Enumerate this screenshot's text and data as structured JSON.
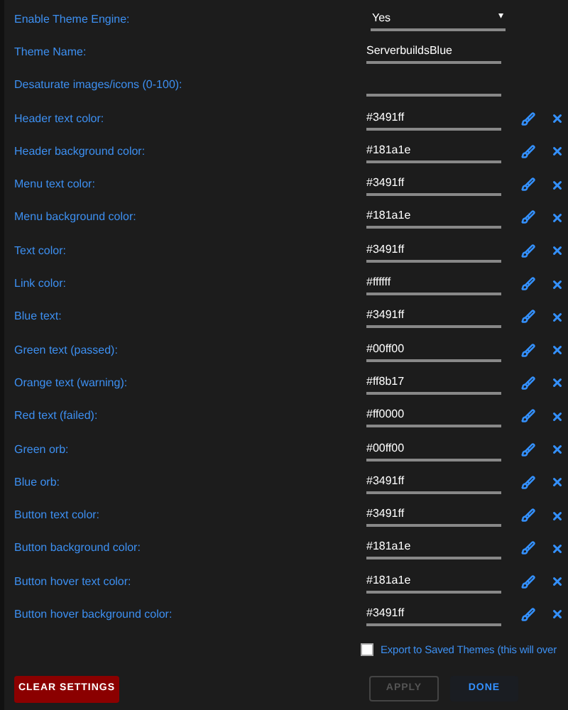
{
  "fields": [
    {
      "kind": "select",
      "label": "Enable Theme Engine:",
      "value": "Yes",
      "caret": "▾"
    },
    {
      "kind": "text",
      "label": "Theme Name:",
      "value": "ServerbuildsBlue"
    },
    {
      "kind": "text",
      "label": "Desaturate images/icons (0-100):"
    },
    {
      "kind": "color",
      "label": "Header text color:",
      "value": "#3491ff"
    },
    {
      "kind": "color",
      "label": "Header background color:",
      "value": "#181a1e"
    },
    {
      "kind": "color",
      "label": "Menu text color:",
      "value": "#3491ff"
    },
    {
      "kind": "color",
      "label": "Menu background color:",
      "value": "#181a1e"
    },
    {
      "kind": "color",
      "label": "Text color:",
      "value": "#3491ff"
    },
    {
      "kind": "color",
      "label": "Link color:",
      "value": "#ffffff"
    },
    {
      "kind": "color",
      "label": "Blue text:",
      "value": "#3491ff"
    },
    {
      "kind": "color",
      "label": "Green text (passed):",
      "value": "#00ff00"
    },
    {
      "kind": "color",
      "label": "Orange text (warning):",
      "value": "#ff8b17"
    },
    {
      "kind": "color",
      "label": "Red text (failed):",
      "value": "#ff0000"
    },
    {
      "kind": "color",
      "label": "Green orb:",
      "value": "#00ff00"
    },
    {
      "kind": "color",
      "label": "Blue orb:",
      "value": "#3491ff"
    },
    {
      "kind": "color",
      "label": "Button text color:",
      "value": "#3491ff"
    },
    {
      "kind": "color",
      "label": "Button background color:",
      "value": "#181a1e"
    },
    {
      "kind": "color",
      "label": "Button hover text color:",
      "value": "#181a1e"
    },
    {
      "kind": "color",
      "label": "Button hover background color:",
      "value": "#3491ff"
    }
  ],
  "export": {
    "label": "Export to Saved Themes (this will over",
    "checked": false
  },
  "buttons": {
    "clear": {
      "label": "CLEAR SETTINGS"
    },
    "apply": {
      "label": "APPLY",
      "disabled": true
    },
    "done": {
      "label": "DONE"
    }
  }
}
